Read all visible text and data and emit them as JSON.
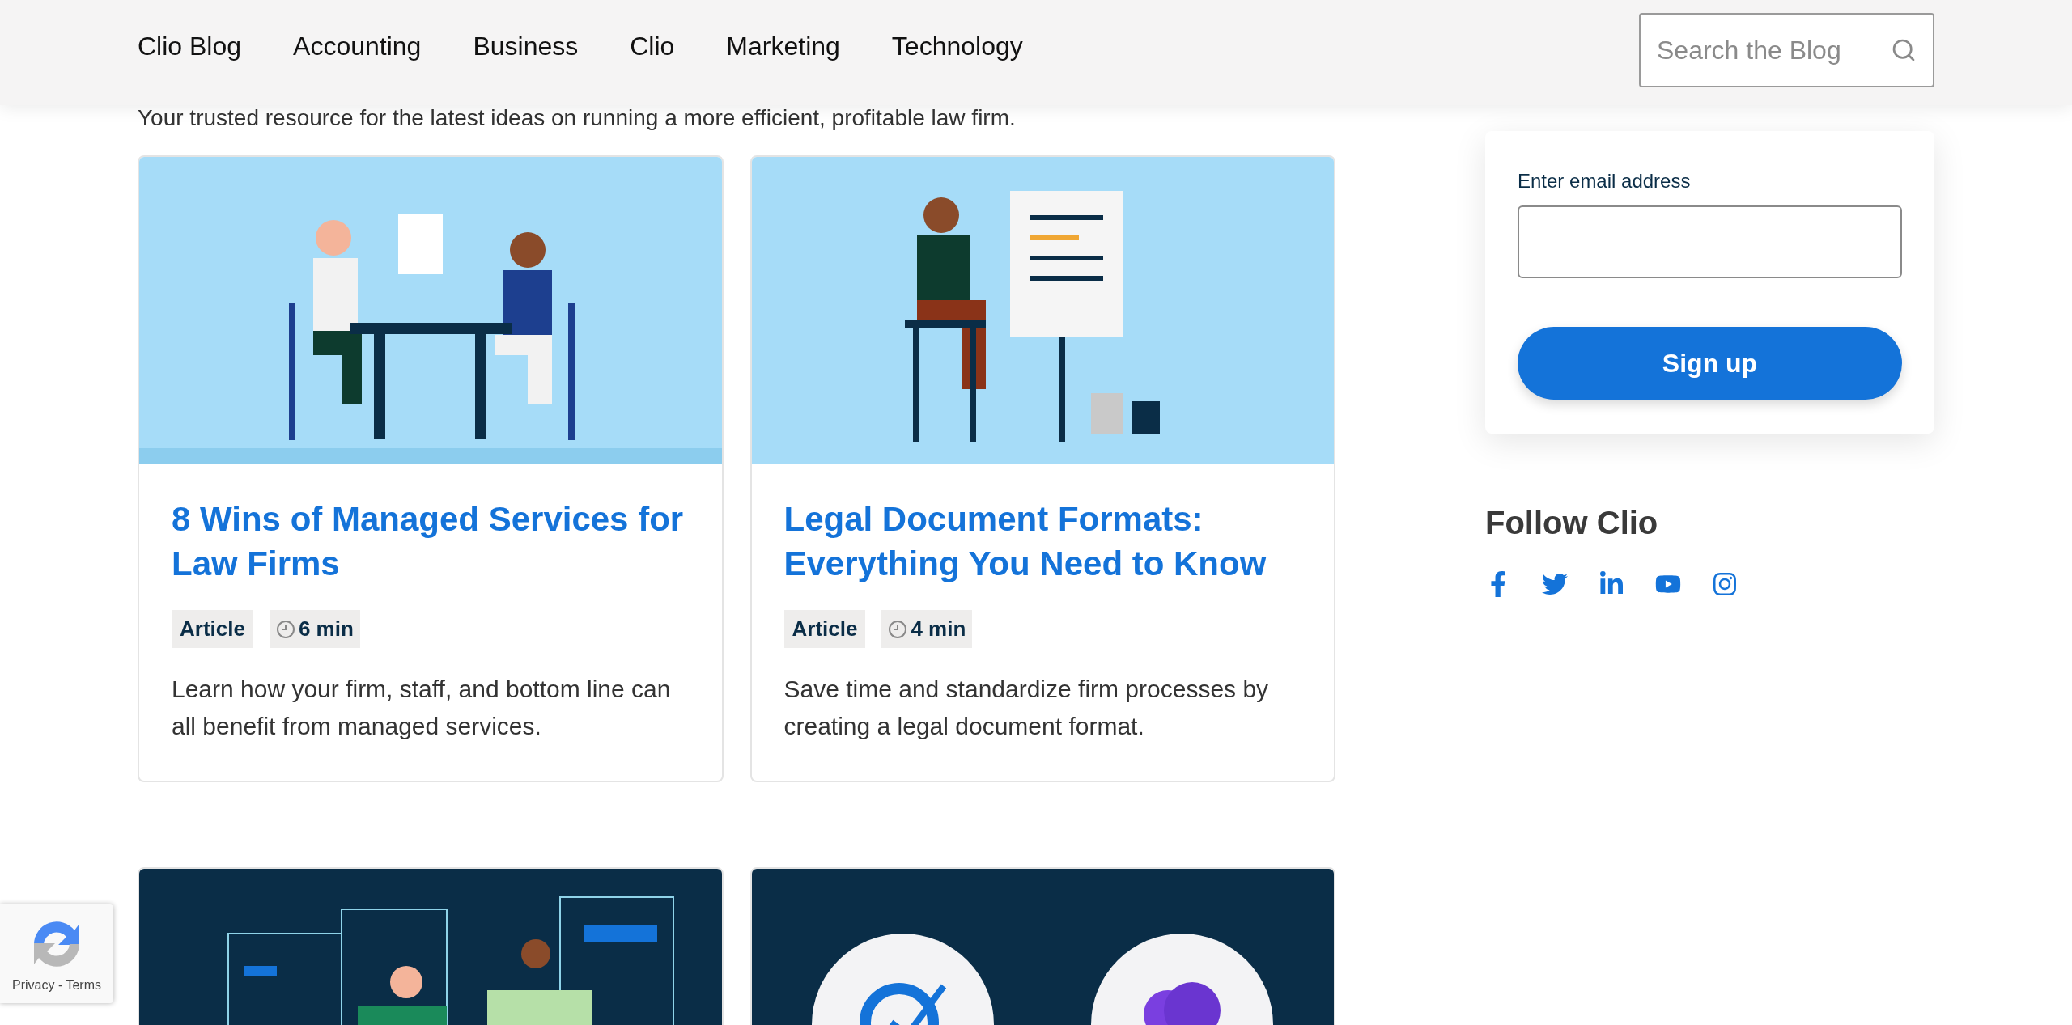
{
  "nav": {
    "items": [
      {
        "label": "Clio Blog"
      },
      {
        "label": "Accounting"
      },
      {
        "label": "Business"
      },
      {
        "label": "Clio"
      },
      {
        "label": "Marketing"
      },
      {
        "label": "Technology"
      }
    ]
  },
  "search": {
    "placeholder": "Search the Blog"
  },
  "tagline": "Your trusted resource for the latest ideas on running a more efficient, profitable law firm.",
  "articles": [
    {
      "title": "8 Wins of Managed Services for Law Firms",
      "type": "Article",
      "read_time": "6 min",
      "description": "Learn how your firm, staff, and bottom line can all benefit from managed services.",
      "kind": "meeting"
    },
    {
      "title": "Legal Document Formats: Everything You Need to Know",
      "type": "Article",
      "read_time": "4 min",
      "description": "Save time and standardize firm processes by creating a legal document format.",
      "kind": "easel"
    }
  ],
  "more_articles": [
    {
      "kind": "screens"
    },
    {
      "kind": "logos"
    }
  ],
  "signup": {
    "label": "Enter email address",
    "button": "Sign up"
  },
  "follow": {
    "title": "Follow Clio",
    "links": [
      {
        "kind": "facebook"
      },
      {
        "kind": "twitter"
      },
      {
        "kind": "linkedin"
      },
      {
        "kind": "youtube"
      },
      {
        "kind": "instagram"
      }
    ]
  },
  "recaptcha": {
    "links": "Privacy - Terms"
  }
}
